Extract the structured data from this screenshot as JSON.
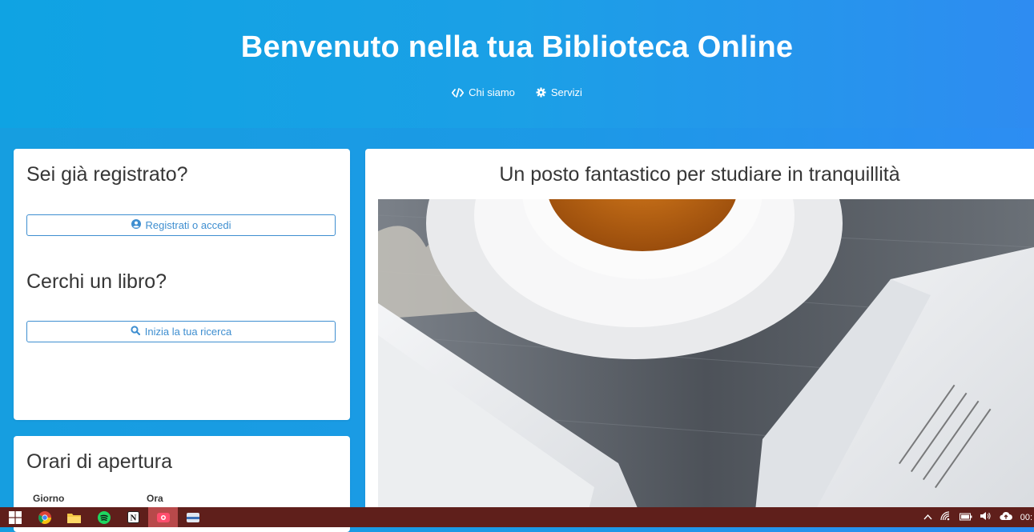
{
  "hero": {
    "title": "Benvenuto nella tua Biblioteca Online",
    "nav": [
      {
        "label": "Chi siamo",
        "icon": "code-icon"
      },
      {
        "label": "Servizi",
        "icon": "gear-icon"
      }
    ]
  },
  "login_card": {
    "registered_heading": "Sei già registrato?",
    "register_button": "Registrati o accedi",
    "search_heading": "Cerchi un libro?",
    "search_button": "Inizia la tua ricerca"
  },
  "hours_card": {
    "heading": "Orari di apertura",
    "columns": [
      "Giorno",
      "Ora"
    ]
  },
  "feature_card": {
    "heading": "Un posto fantastico per studiare in tranquillità",
    "image": "photo-tea-cup-and-open-books"
  },
  "taskbar": {
    "apps": [
      "windows-start-icon",
      "chrome-icon",
      "file-explorer-icon",
      "spotify-icon",
      "notion-icon",
      "screen-recorder-icon",
      "app-icon"
    ],
    "clock": "00:"
  },
  "colors": {
    "accent": "#3e8ed0",
    "hero_gradient_start": "#0fa3e3",
    "hero_gradient_end": "#2e8cf1",
    "taskbar": "#5f1f1b"
  }
}
